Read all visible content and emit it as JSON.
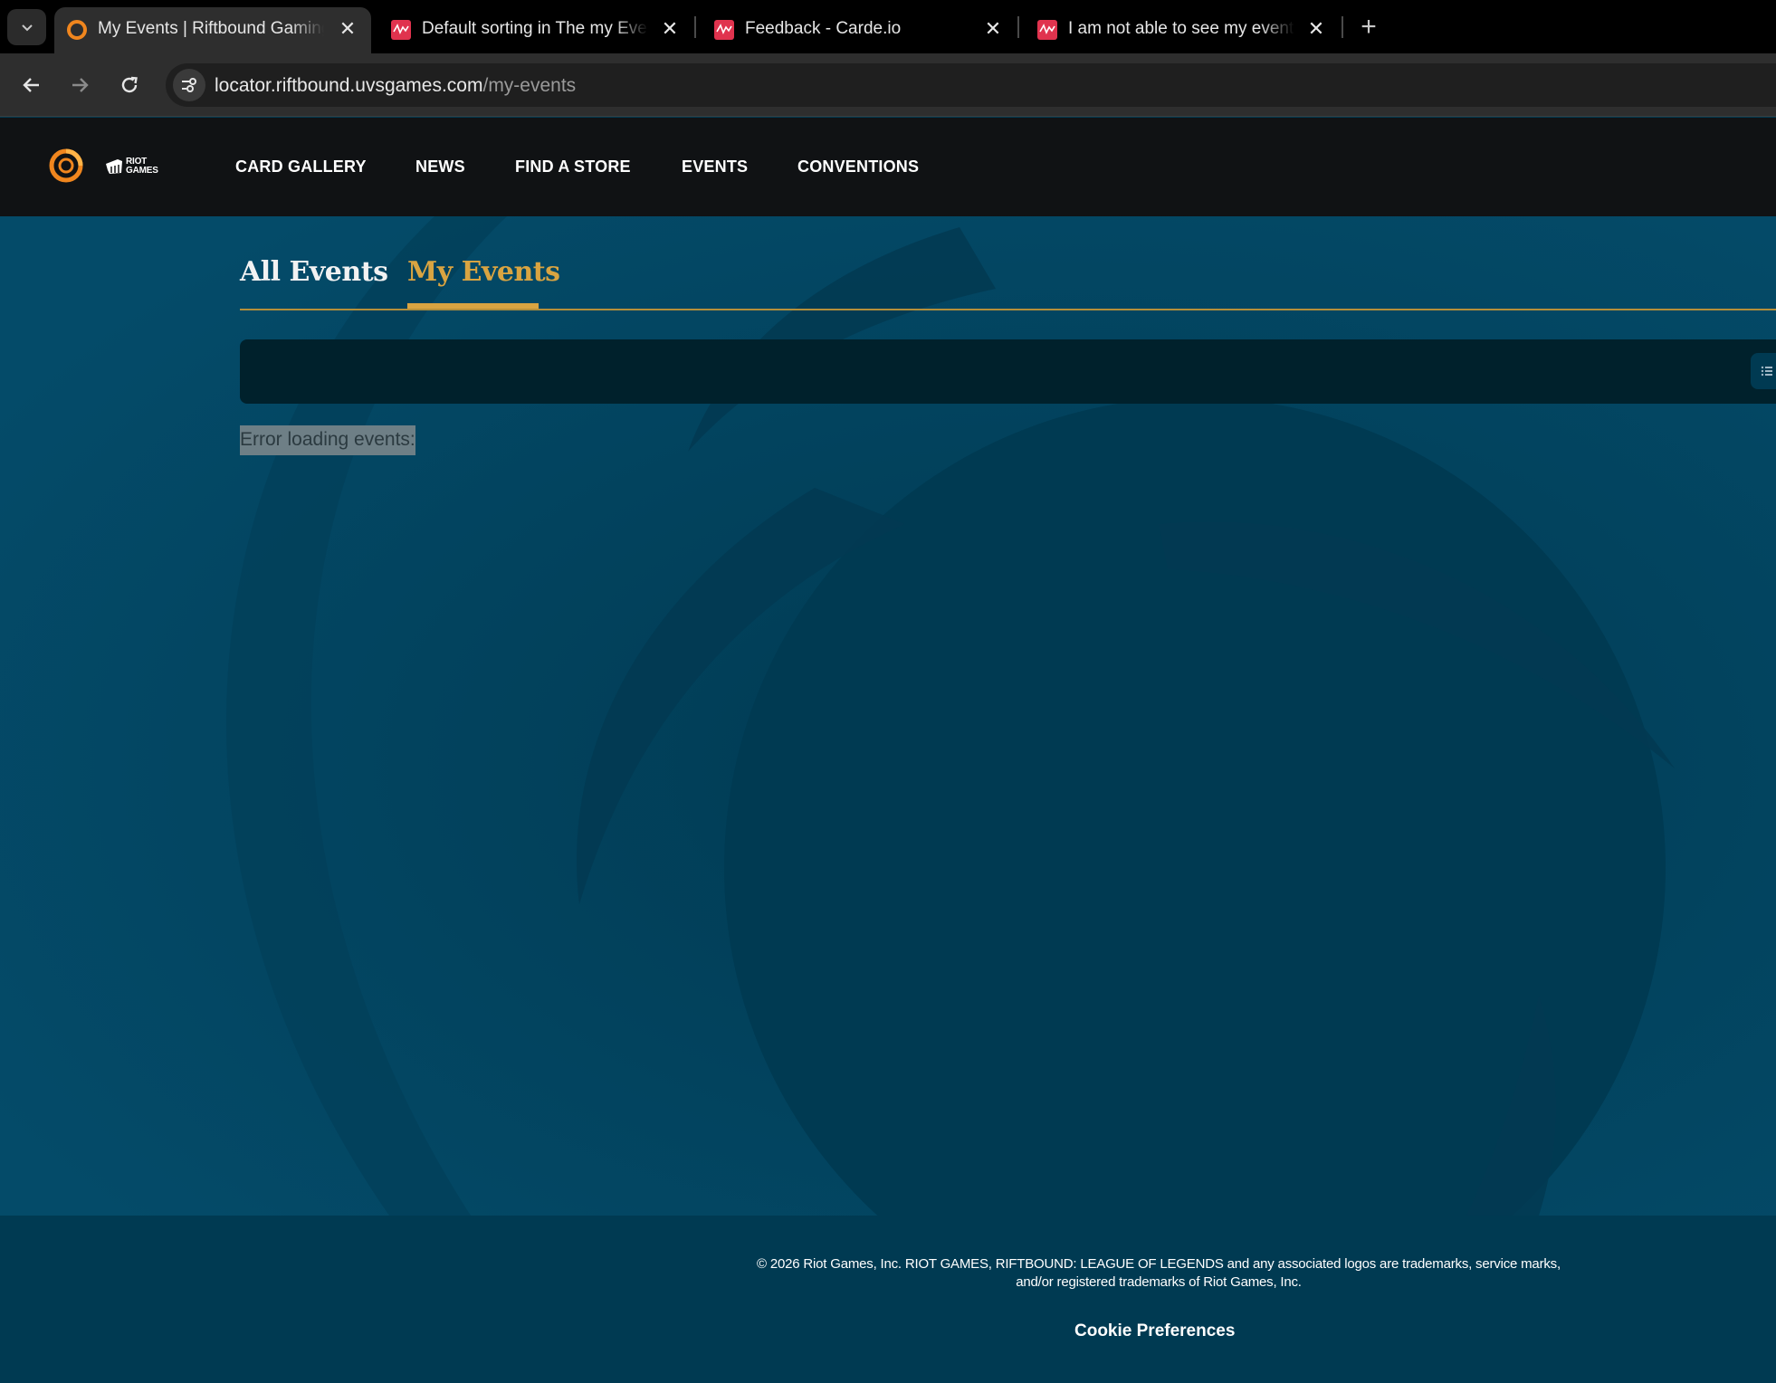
{
  "browser": {
    "tabs": [
      {
        "title": "My Events | Riftbound Gaming Locator",
        "active": true,
        "favicon": "riftbound-icon"
      },
      {
        "title": "Default sorting in The my Events page",
        "active": false,
        "favicon": "carde-icon"
      },
      {
        "title": "Feedback - Carde.io",
        "active": false,
        "favicon": "carde-icon"
      },
      {
        "title": "I am not able to see my events.",
        "active": false,
        "favicon": "carde-icon"
      }
    ],
    "url_host": "locator.riftbound.uvsgames.com",
    "url_path": "/my-events"
  },
  "header": {
    "riot_logo_text": "RIOT GAMES",
    "nav": [
      "CARD GALLERY",
      "NEWS",
      "FIND A STORE",
      "EVENTS",
      "CONVENTIONS"
    ]
  },
  "main": {
    "tabs": [
      {
        "label": "All Events",
        "active": false
      },
      {
        "label": "My Events",
        "active": true
      }
    ],
    "error_message": "Error loading events:"
  },
  "footer": {
    "legal_line1": "© 2026 Riot Games, Inc. RIOT GAMES, RIFTBOUND: LEAGUE OF LEGENDS and any associated logos are trademarks, service marks,",
    "legal_line2": "and/or registered trademarks of Riot Games, Inc.",
    "cookie_label": "Cookie Preferences"
  },
  "colors": {
    "accent": "#d9a441",
    "page_bg": "#03445f",
    "header_bg": "#101214",
    "filter_bar": "#00212c",
    "tab_favicon_red": "#e0334e",
    "brand_orange": "#f0861e"
  }
}
